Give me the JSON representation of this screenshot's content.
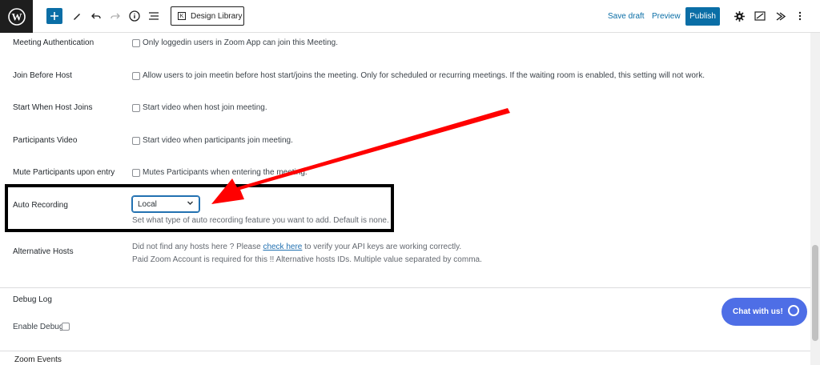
{
  "toolbar": {
    "design_library_label": "Design Library",
    "save_draft_label": "Save draft",
    "preview_label": "Preview",
    "publish_label": "Publish"
  },
  "settings": {
    "meeting_auth_label": "Meeting Authentication",
    "meeting_auth_text": "Only loggedin users in Zoom App can join this Meeting.",
    "join_before_host_label": "Join Before Host",
    "join_before_host_text": "Allow users to join meetin before host start/joins the meeting. Only for scheduled or recurring meetings. If the waiting room is enabled, this setting will not work.",
    "start_when_host_label": "Start When Host Joins",
    "start_when_host_text": "Start video when host join meeting.",
    "participants_video_label": "Participants Video",
    "participants_video_text": "Start video when participants join meeting.",
    "mute_participants_label": "Mute Participants upon entry",
    "mute_participants_text": "Mutes Participants when entering the meeting.",
    "auto_recording_label": "Auto Recording",
    "auto_recording_value": "Local",
    "auto_recording_help": "Set what type of auto recording feature you want to add. Default is none.",
    "alt_hosts_label": "Alternative Hosts",
    "alt_hosts_help_prefix": "Did not find any hosts here ? Please",
    "alt_hosts_link": "check here",
    "alt_hosts_help_suffix": "to verify your API keys are working correctly.",
    "alt_hosts_help2": "Paid Zoom Account is required for this !! Alternative hosts IDs. Multiple value separated by comma."
  },
  "debug": {
    "title": "Debug Log",
    "enable_label": "Enable Debug?"
  },
  "footer": {
    "zoom_events_label": "Zoom Events"
  },
  "chat": {
    "label": "Chat with us!"
  },
  "colors": {
    "accent": "#0a6ea6",
    "chat": "#4e6ee6",
    "arrow": "#ff0000"
  },
  "icons": [
    "wordpress-logo",
    "plus-icon",
    "pen-icon",
    "undo-icon",
    "redo-icon",
    "info-icon",
    "list-view-icon",
    "settings-icon",
    "style-icon",
    "plugin-icon",
    "more-icon",
    "chevron-down-icon",
    "chevron-up-icon",
    "chat-bubble-icon"
  ]
}
